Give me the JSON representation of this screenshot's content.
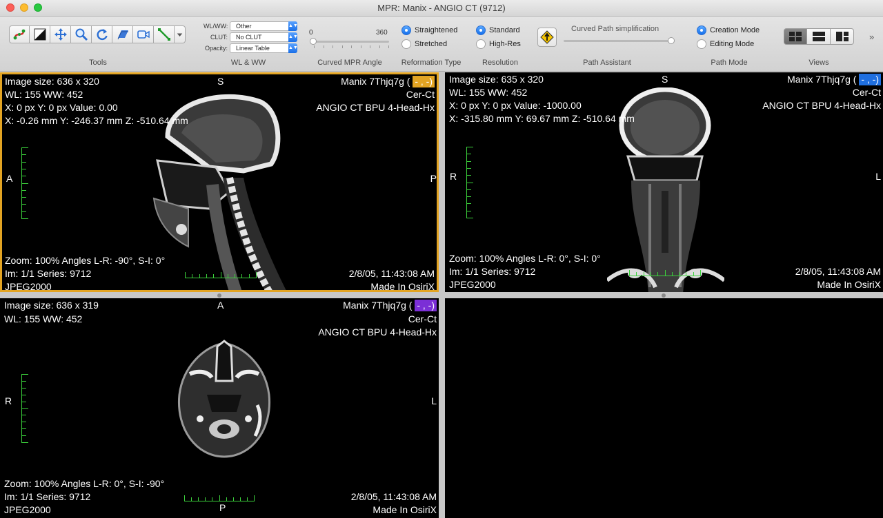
{
  "window": {
    "title": "MPR: Manix - ANGIO CT (9712)"
  },
  "toolbar": {
    "sections": {
      "tools": "Tools",
      "wlww": "WL & WW",
      "curved_angle": "Curved MPR Angle",
      "reformation": "Reformation Type",
      "resolution": "Resolution",
      "path_assistant": "Path Assistant",
      "path_mode": "Path Mode",
      "views": "Views"
    },
    "tool_icons": [
      "curved-path-icon",
      "contrast-icon",
      "move-icon",
      "zoom-icon",
      "rotate-icon",
      "slab-icon",
      "movie-icon",
      "measure-icon",
      "dropdown-icon"
    ],
    "wl_label": "WL/WW:",
    "wl_value": "Other",
    "clut_label": "CLUT:",
    "clut_value": "No CLUT",
    "opacity_label": "Opacity:",
    "opacity_value": "Linear Table",
    "angle_min": "0",
    "angle_max": "360",
    "angle_value": 0,
    "reformation": {
      "straightened": "Straightened",
      "stretched": "Stretched",
      "selected": "Straightened"
    },
    "resolution": {
      "standard": "Standard",
      "high_res": "High-Res",
      "selected": "Standard"
    },
    "path_simplification_label": "Curved Path simplification",
    "path_simplification_value": 0.97,
    "path_mode": {
      "creation": "Creation Mode",
      "editing": "Editing Mode",
      "selected": "Creation Mode"
    },
    "more_glyph": "»"
  },
  "viewports": {
    "sagittal": {
      "image_size": "Image size: 636 x 320",
      "wlww": "WL: 155 WW: 452",
      "px_value": "X: 0 px Y: 0 px Value: 0.00",
      "mm_coords": "X: -0.26 mm Y: -246.37 mm Z: -510.64 mm",
      "patient": "Manix 7Thjq7g (",
      "badge": "- , -)",
      "badge_color": "#e3a423",
      "study": "Cer-Ct",
      "series_desc": "ANGIO CT BPU 4-Head-Hx",
      "top": "S",
      "left": "A",
      "right": "P",
      "zoom": "Zoom: 100% Angles L-R: -90°, S-I: 0°",
      "im": "Im: 1/1  Series:  9712",
      "date": "2/8/05, 11:43:08 AM",
      "codec": "JPEG2000",
      "made": "Made In OsiriX"
    },
    "coronal": {
      "image_size": "Image size: 635 x 320",
      "wlww": "WL: 155 WW: 452",
      "px_value": "X: 0 px Y: 0 px Value: -1000.00",
      "mm_coords": "X: -315.80 mm Y: 69.67 mm Z: -510.64 mm",
      "patient": "Manix 7Thjq7g (",
      "badge": "- , -)",
      "badge_color": "#1f6fe0",
      "study": "Cer-Ct",
      "series_desc": "ANGIO CT BPU 4-Head-Hx",
      "top": "S",
      "left": "R",
      "right": "L",
      "zoom": "Zoom: 100% Angles L-R: 0°, S-I: 0°",
      "im": "Im: 1/1  Series:  9712",
      "date": "2/8/05, 11:43:08 AM",
      "codec": "JPEG2000",
      "made": "Made In OsiriX"
    },
    "axial": {
      "image_size": "Image size: 636 x 319",
      "wlww": "WL: 155 WW: 452",
      "patient": "Manix 7Thjq7g (",
      "badge": "- , -)",
      "badge_color": "#7b2fd6",
      "study": "Cer-Ct",
      "series_desc": "ANGIO CT BPU 4-Head-Hx",
      "top": "A",
      "bottom": "P",
      "left": "R",
      "right": "L",
      "zoom": "Zoom: 100% Angles L-R: 0°, S-I: -90°",
      "im": "Im: 1/1  Series:  9712",
      "date": "2/8/05, 11:43:08 AM",
      "codec": "JPEG2000",
      "made": "Made In OsiriX"
    }
  }
}
